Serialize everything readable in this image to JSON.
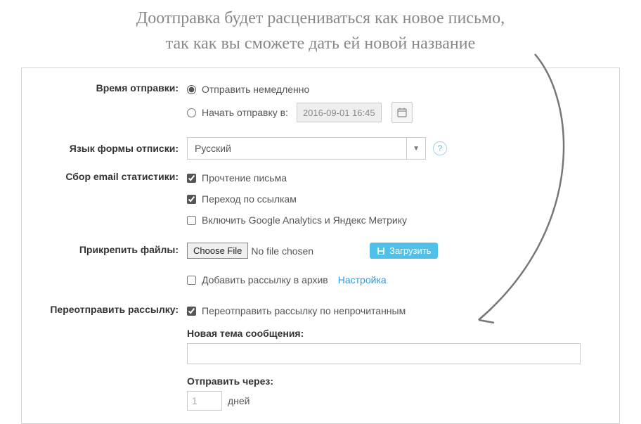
{
  "annotation": {
    "line1": "Доотправка будет расцениваться как новое письмо,",
    "line2": "так как вы сможете дать ей новой название"
  },
  "labels": {
    "send_time": "Время отправки:",
    "unsub_lang": "Язык формы отписки:",
    "stats": "Сбор email статистики:",
    "attach": "Прикрепить файлы:",
    "resend": "Переотправить рассылку:"
  },
  "send_time": {
    "immediate": "Отправить немедленно",
    "scheduled": "Начать отправку в:",
    "datetime": "2016-09-01 16:45"
  },
  "lang": {
    "selected": "Русский"
  },
  "stats": {
    "open": "Прочтение письма",
    "click": "Переход по ссылкам",
    "analytics": "Включить Google Analytics и Яндекс Метрику"
  },
  "attach": {
    "choose_btn": "Choose File",
    "no_file": "No file chosen",
    "upload_btn": "Загрузить",
    "archive": "Добавить рассылку в архив",
    "settings_link": "Настройка"
  },
  "resend": {
    "checkbox": "Переотправить рассылку по непрочитанным",
    "new_subject_label": "Новая тема сообщения:",
    "send_after_label": "Отправить через:",
    "days_value": "1",
    "days_unit": "дней"
  }
}
